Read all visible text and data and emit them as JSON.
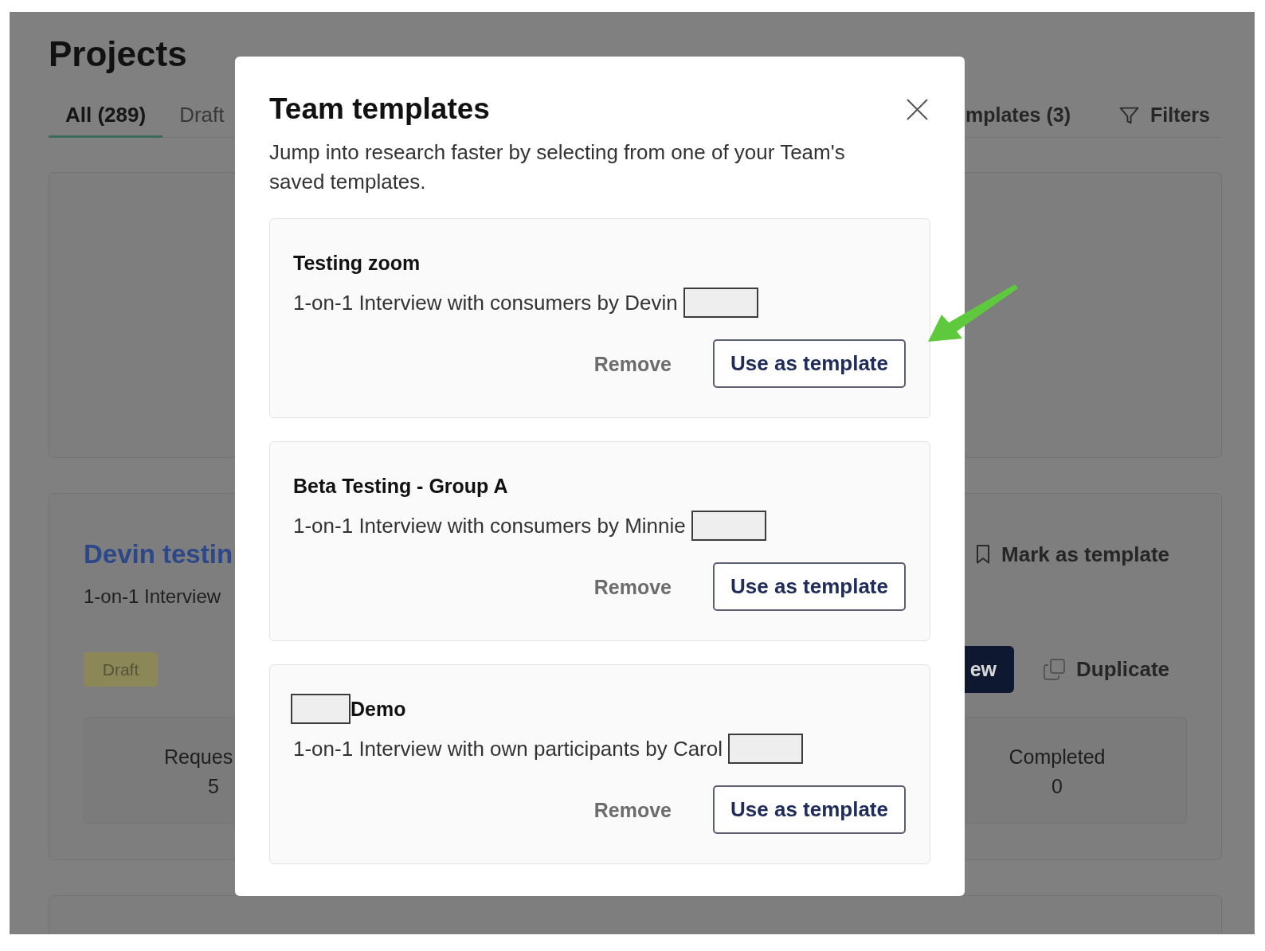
{
  "page": {
    "title": "Projects",
    "tabs": [
      {
        "label": "All (289)",
        "selected": true
      },
      {
        "label": "Draft",
        "selected": false
      }
    ],
    "templates_button": "mplates (3)",
    "filters_button": "Filters",
    "project_cards": [
      {
        "kind": "covered"
      },
      {
        "kind": "project",
        "title": "Devin testin",
        "description": "1-on-1 Interview",
        "status": "Draft",
        "mark_template_action": "Mark as template",
        "primary_action": "ew",
        "duplicate_action": "Duplicate",
        "stats": [
          {
            "label": "Reques",
            "value": "5"
          },
          {
            "label": "Completed",
            "value": "0"
          }
        ]
      },
      {
        "kind": "cut_off"
      }
    ]
  },
  "modal": {
    "title": "Team templates",
    "description": "Jump into research faster by selecting from one of your Team's saved templates.",
    "templates": [
      {
        "title": "Testing zoom",
        "title_redacted": false,
        "description": "1-on-1 Interview with consumers by Devin",
        "author_redacted": true,
        "remove_label": "Remove",
        "use_label": "Use as template"
      },
      {
        "title": "Beta Testing - Group A",
        "title_redacted": false,
        "description": "1-on-1 Interview with consumers by Minnie",
        "author_redacted": true,
        "remove_label": "Remove",
        "use_label": "Use as template"
      },
      {
        "title": "Demo",
        "title_redacted": true,
        "description": "1-on-1 Interview with own participants by Carol",
        "author_redacted": true,
        "remove_label": "Remove",
        "use_label": "Use as template"
      }
    ]
  }
}
